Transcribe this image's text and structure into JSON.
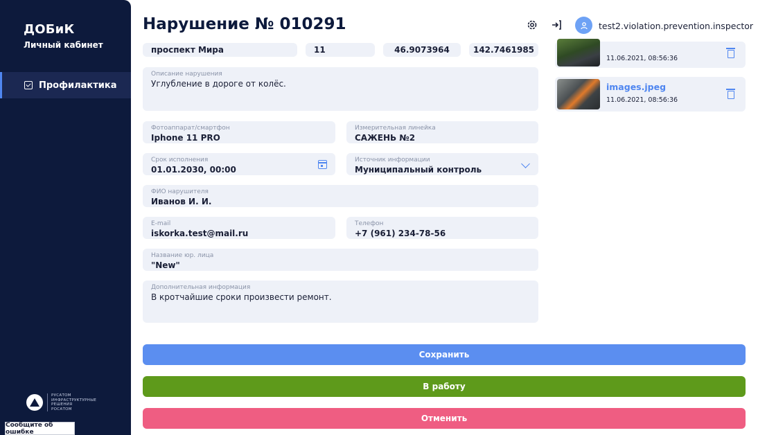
{
  "sidebar": {
    "brand": "ДОБиК",
    "subtitle": "Личный кабинет",
    "nav": [
      {
        "label": "Профилактика",
        "icon": "checkbox-icon",
        "active": true
      }
    ],
    "logo_lines": [
      "РУСАТОМ",
      "ИНФРАСТРУКТУРНЫЕ",
      "РЕШЕНИЯ",
      "РОСАТОМ"
    ],
    "report_label": "Сообщите об ошибке"
  },
  "header": {
    "title": "Нарушение № 010291",
    "username": "test2.violation.prevention.inspector",
    "icons": [
      "gear-icon",
      "logout-icon",
      "user-icon"
    ]
  },
  "address": {
    "street": "проспект Мира",
    "house": "11",
    "lat": "46.9073964",
    "lon": "142.7461985"
  },
  "form": {
    "description": {
      "label": "Описание нарушения",
      "value": "Углубление в дороге от колёс."
    },
    "camera": {
      "label": "Фотоаппарат/смартфон",
      "value": "Iphone 11 PRO"
    },
    "ruler": {
      "label": "Измерительная линейка",
      "value": "САЖЕНЬ №2"
    },
    "deadline": {
      "label": "Срок исполнения",
      "value": "01.01.2030, 00:00"
    },
    "source": {
      "label": "Источник информации",
      "value": "Муниципальный контроль"
    },
    "violator": {
      "label": "ФИО нарушителя",
      "value": "Иванов И. И."
    },
    "email": {
      "label": "E-mail",
      "value": "iskorka.test@mail.ru"
    },
    "phone": {
      "label": "Телефон",
      "value": "+7 (961) 234-78-56"
    },
    "legal": {
      "label": "Название юр. лица",
      "value": "\"New\""
    },
    "extra": {
      "label": "Дополнительная информация",
      "value": "В кротчайшие сроки произвести ремонт."
    }
  },
  "attachments": [
    {
      "name": "",
      "date": "11.06.2021, 08:56:36"
    },
    {
      "name": "images.jpeg",
      "date": "11.06.2021, 08:56:36"
    }
  ],
  "buttons": {
    "save": "Сохранить",
    "work": "В работу",
    "cancel": "Отменить"
  },
  "colors": {
    "sidebar": "#0d1a3c",
    "accent": "#4f86f0",
    "save": "#5b8ef0",
    "work": "#5e9a1b",
    "cancel": "#ef5d82"
  }
}
